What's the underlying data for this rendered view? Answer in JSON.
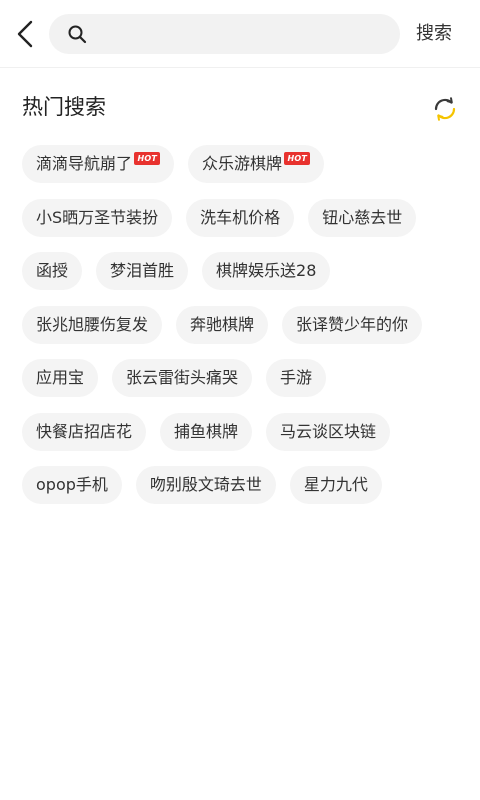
{
  "topbar": {
    "back_icon": "chevron-left-icon",
    "search_icon": "search-icon",
    "search_value": "",
    "search_placeholder": "",
    "search_button": "搜索"
  },
  "hot_search": {
    "title": "热门搜索",
    "refresh_icon": "refresh-icon",
    "hot_badge": "HOT",
    "rows": [
      [
        {
          "label": "滴滴导航崩了",
          "hot": true
        },
        {
          "label": "众乐游棋牌",
          "hot": true
        }
      ],
      [
        {
          "label": "小S晒万圣节装扮",
          "hot": false
        },
        {
          "label": "洗车机价格",
          "hot": false
        },
        {
          "label": "钮心慈去世",
          "hot": false
        }
      ],
      [
        {
          "label": "函授",
          "hot": false
        },
        {
          "label": "梦泪首胜",
          "hot": false
        },
        {
          "label": "棋牌娱乐送28",
          "hot": false
        }
      ],
      [
        {
          "label": "张兆旭腰伤复发",
          "hot": false
        },
        {
          "label": "奔驰棋牌",
          "hot": false
        },
        {
          "label": "张译赞少年的你",
          "hot": false
        }
      ],
      [
        {
          "label": "应用宝",
          "hot": false
        },
        {
          "label": "张云雷街头痛哭",
          "hot": false
        },
        {
          "label": "手游",
          "hot": false
        }
      ],
      [
        {
          "label": "快餐店招店花",
          "hot": false
        },
        {
          "label": "捕鱼棋牌",
          "hot": false
        },
        {
          "label": "马云谈区块链",
          "hot": false
        }
      ],
      [
        {
          "label": "opop手机",
          "hot": false
        },
        {
          "label": "吻别殷文琦去世",
          "hot": false
        },
        {
          "label": "星力九代",
          "hot": false
        }
      ]
    ]
  },
  "colors": {
    "hot_badge": "#e8322e",
    "refresh_accent": "#f5c400",
    "tag_background": "#f4f4f4",
    "search_background": "#f2f2f2"
  }
}
